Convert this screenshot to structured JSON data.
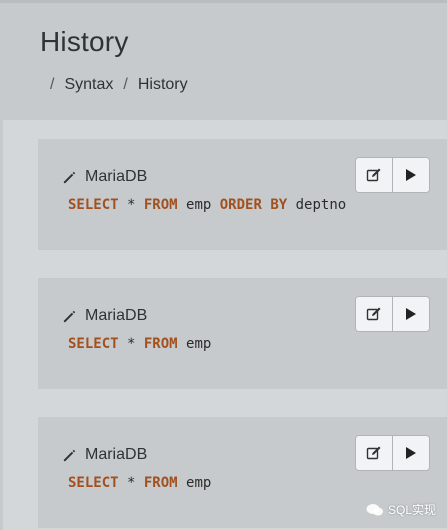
{
  "page": {
    "title": "History",
    "breadcrumb": [
      {
        "separator": "/",
        "label": "Syntax"
      },
      {
        "separator": "/",
        "label": "History"
      }
    ]
  },
  "history": [
    {
      "db": "MariaDB",
      "tokens": [
        {
          "t": "SELECT",
          "kw": true
        },
        {
          "t": " * ",
          "kw": false
        },
        {
          "t": "FROM",
          "kw": true
        },
        {
          "t": " emp ",
          "kw": false
        },
        {
          "t": "ORDER BY",
          "kw": true
        },
        {
          "t": " deptno",
          "kw": false
        }
      ]
    },
    {
      "db": "MariaDB",
      "tokens": [
        {
          "t": "SELECT",
          "kw": true
        },
        {
          "t": " * ",
          "kw": false
        },
        {
          "t": "FROM",
          "kw": true
        },
        {
          "t": " emp",
          "kw": false
        }
      ]
    },
    {
      "db": "MariaDB",
      "tokens": [
        {
          "t": "SELECT",
          "kw": true
        },
        {
          "t": " * ",
          "kw": false
        },
        {
          "t": "FROM",
          "kw": true
        },
        {
          "t": " emp",
          "kw": false
        }
      ]
    }
  ],
  "icons": {
    "title": "pencil-icon",
    "edit": "edit-icon",
    "run": "play-icon"
  },
  "colors": {
    "keyword": "#a3501f",
    "text": "#2f3336",
    "card_bg": "#c6cacc",
    "content_bg": "#d3d7d9"
  },
  "watermark": "SQL实现"
}
